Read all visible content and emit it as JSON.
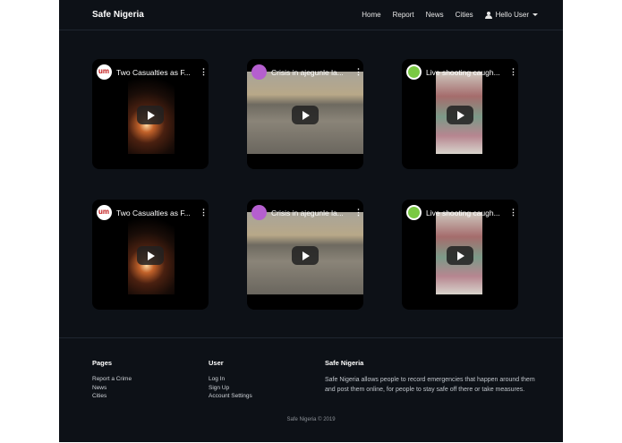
{
  "nav": {
    "brand": "Safe Nigeria",
    "links": [
      "Home",
      "Report",
      "News",
      "Cities"
    ],
    "user": "Hello User"
  },
  "videos": [
    {
      "title": "Two Casualties as F...",
      "channel_icon": "um-logo",
      "thumb": "fire"
    },
    {
      "title": "Crisis in ajegunle la...",
      "channel_icon": "purple-avatar",
      "thumb": "street"
    },
    {
      "title": "Live shooting caugh...",
      "channel_icon": "green-logo",
      "thumb": "market"
    },
    {
      "title": "Two Casualties as F...",
      "channel_icon": "um-logo",
      "thumb": "fire"
    },
    {
      "title": "Crisis in ajegunle la...",
      "channel_icon": "purple-avatar",
      "thumb": "street"
    },
    {
      "title": "Live shooting caugh...",
      "channel_icon": "green-logo",
      "thumb": "market"
    }
  ],
  "footer": {
    "pages": {
      "heading": "Pages",
      "links": [
        "Report a Crime",
        "News",
        "Cities"
      ]
    },
    "user": {
      "heading": "User",
      "links": [
        "Log In",
        "Sign Up",
        "Account Settings"
      ]
    },
    "about": {
      "heading": "Safe Nigeria",
      "text": "Safe Nigeria allows people to record emergencies that happen around them and post them online, for people to stay safe off there or take measures."
    },
    "copyright": "Safe Nigeria © 2019"
  },
  "colors": {
    "page_bg": "#0d1117",
    "card_bg": "#000000",
    "text": "#ffffff"
  }
}
